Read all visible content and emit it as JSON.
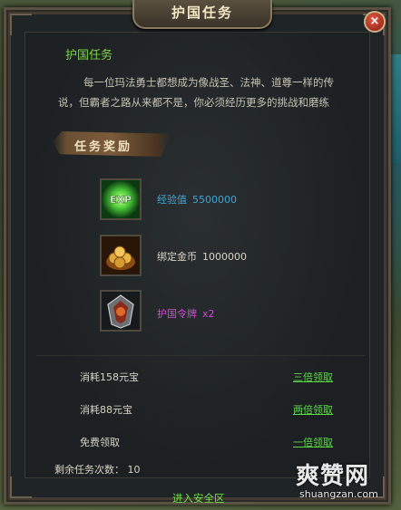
{
  "window": {
    "title": "护国任务",
    "close_label": "×"
  },
  "quest": {
    "name": "护国任务",
    "description": "每一位玛法勇士都想成为像战圣、法神、道尊一样的传说，但霸者之路从来都不是，你必须经历更多的挑战和磨练"
  },
  "rewards": {
    "section_label": "任务奖励",
    "items": [
      {
        "icon": "exp-orb-icon",
        "name": "经验值",
        "quantity": "5500000",
        "color": "#3ea6d8"
      },
      {
        "icon": "gold-coins-icon",
        "name": "绑定金币",
        "quantity": "1000000",
        "color": "#d8d4c5"
      },
      {
        "icon": "guard-token-icon",
        "name": "护国令牌",
        "quantity": "x2",
        "color": "#d14bd6"
      }
    ]
  },
  "claims": [
    {
      "cost": "消耗158元宝",
      "action": "三倍领取"
    },
    {
      "cost": "消耗88元宝",
      "action": "两倍领取"
    },
    {
      "cost": "免费领取",
      "action": "一倍领取"
    }
  ],
  "remaining": "剩余任务次数： 10",
  "footer_link": "进入安全区",
  "watermark": {
    "main": "爽赞网",
    "sub": "shuangzan.com"
  }
}
